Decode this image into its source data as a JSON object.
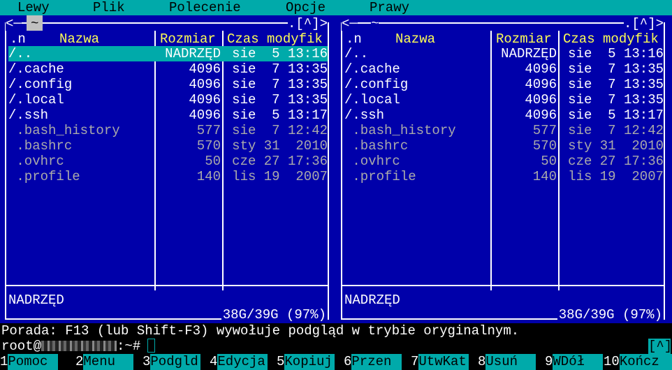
{
  "menubar": [
    "Lewy",
    "Plik",
    "Polecenie",
    "Opcje",
    "Prawy"
  ],
  "panels": {
    "left": {
      "path": "~",
      "frame_left": "<─",
      "frame_mid": "~",
      "frame_right": ".[^]>",
      "headers": {
        "sort": ".n",
        "name": "Nazwa",
        "size": "Rozmiar",
        "mtime": "Czas modyfik"
      },
      "selected_index": 0,
      "rows": [
        {
          "name": "/..",
          "size": "NADRZĘD",
          "mtime": "sie  5 13:16",
          "kind": "dir"
        },
        {
          "name": "/.cache",
          "size": "4096",
          "mtime": "sie  7 13:35",
          "kind": "dir"
        },
        {
          "name": "/.config",
          "size": "4096",
          "mtime": "sie  7 13:35",
          "kind": "dir"
        },
        {
          "name": "/.local",
          "size": "4096",
          "mtime": "sie  7 13:35",
          "kind": "dir"
        },
        {
          "name": "/.ssh",
          "size": "4096",
          "mtime": "sie  5 13:17",
          "kind": "dir"
        },
        {
          "name": " .bash_history",
          "size": "577",
          "mtime": "sie  7 12:42",
          "kind": "file"
        },
        {
          "name": " .bashrc",
          "size": "570",
          "mtime": "sty 31  2010",
          "kind": "file"
        },
        {
          "name": " .ovhrc",
          "size": "50",
          "mtime": "cze 27 17:36",
          "kind": "file"
        },
        {
          "name": " .profile",
          "size": "140",
          "mtime": "lis 19  2007",
          "kind": "file"
        }
      ],
      "mini_status": "NADRZĘD",
      "disk_info": "38G/39G (97%)"
    },
    "right": {
      "path": "~",
      "frame_left": "<─",
      "frame_mid": "~",
      "frame_right": ".[^]>",
      "headers": {
        "sort": ".n",
        "name": "Nazwa",
        "size": "Rozmiar",
        "mtime": "Czas modyfik"
      },
      "selected_index": -1,
      "rows": [
        {
          "name": "/..",
          "size": "NADRZĘD",
          "mtime": "sie  5 13:16",
          "kind": "dir"
        },
        {
          "name": "/.cache",
          "size": "4096",
          "mtime": "sie  7 13:35",
          "kind": "dir"
        },
        {
          "name": "/.config",
          "size": "4096",
          "mtime": "sie  7 13:35",
          "kind": "dir"
        },
        {
          "name": "/.local",
          "size": "4096",
          "mtime": "sie  7 13:35",
          "kind": "dir"
        },
        {
          "name": "/.ssh",
          "size": "4096",
          "mtime": "sie  5 13:17",
          "kind": "dir"
        },
        {
          "name": " .bash_history",
          "size": "577",
          "mtime": "sie  7 12:42",
          "kind": "file"
        },
        {
          "name": " .bashrc",
          "size": "570",
          "mtime": "sty 31  2010",
          "kind": "file"
        },
        {
          "name": " .ovhrc",
          "size": "50",
          "mtime": "cze 27 17:36",
          "kind": "file"
        },
        {
          "name": " .profile",
          "size": "140",
          "mtime": "lis 19  2007",
          "kind": "file"
        }
      ],
      "mini_status": "NADRZĘD",
      "disk_info": "38G/39G (97%)"
    }
  },
  "hint": "Porada: F13 (lub Shift-F3) wywołuje podgląd w trybie oryginalnym.",
  "command_line": {
    "user": "root@",
    "suffix": ":~#"
  },
  "history_button": "[^]",
  "function_keys": [
    {
      "num": "1",
      "label": "Pomoc"
    },
    {
      "num": "2",
      "label": "Menu"
    },
    {
      "num": "3",
      "label": "Podgld"
    },
    {
      "num": "4",
      "label": "Edycja"
    },
    {
      "num": "5",
      "label": "Kopiuj"
    },
    {
      "num": "6",
      "label": "Przen"
    },
    {
      "num": "7",
      "label": "UtwKat"
    },
    {
      "num": "8",
      "label": "Usuń"
    },
    {
      "num": "9",
      "label": "WDół"
    },
    {
      "num": "10",
      "label": "Kończ"
    }
  ],
  "colors": {
    "panel_bg": "#0000aa",
    "accent": "#00aaaa",
    "header_text": "#ffff55",
    "file_text": "#aaaaaa",
    "text": "#ffffff"
  }
}
